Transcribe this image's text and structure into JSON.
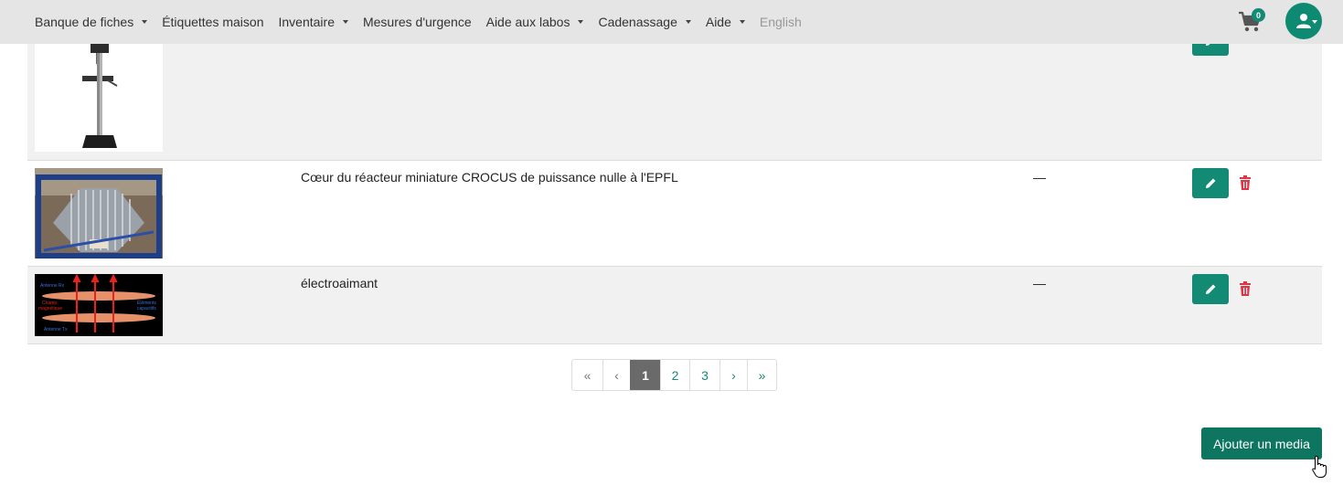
{
  "nav": {
    "items": [
      {
        "label": "Banque de fiches",
        "dropdown": true
      },
      {
        "label": "Étiquettes maison",
        "dropdown": false
      },
      {
        "label": "Inventaire",
        "dropdown": true
      },
      {
        "label": "Mesures d'urgence",
        "dropdown": false
      },
      {
        "label": "Aide aux labos",
        "dropdown": true
      },
      {
        "label": "Cadenassage",
        "dropdown": true
      },
      {
        "label": "Aide",
        "dropdown": true
      },
      {
        "label": "English",
        "dropdown": false
      }
    ],
    "cart_count": "0",
    "cart_icon": "shopping-cart-icon",
    "user_icon": "user-icon"
  },
  "media_rows": [
    {
      "title": "",
      "value": "",
      "thumb": "drill-press-photo"
    },
    {
      "title": "Cœur du réacteur miniature CROCUS de puissance nulle à l'EPFL",
      "value": "—",
      "thumb": "reactor-core-photo"
    },
    {
      "title": "électroaimant",
      "value": "—",
      "thumb": "electromagnet-diagram"
    }
  ],
  "thumb_labels": {
    "antenne_rx": "Antenne Rx",
    "champ": "Champ",
    "magnetique": "magnétique",
    "elements": "Éléments",
    "capacitifs": "capacitifs",
    "antenne_tx": "Antenne Tx"
  },
  "pagination": {
    "first": "«",
    "prev": "‹",
    "pages": [
      "1",
      "2",
      "3"
    ],
    "current": "1",
    "next": "›",
    "last": "»"
  },
  "actions": {
    "add_media": "Ajouter un media"
  },
  "colors": {
    "primary": "#138a73",
    "danger": "#dc3545",
    "navbar": "#e5e5e5",
    "row_shade": "#f1f1f1"
  }
}
